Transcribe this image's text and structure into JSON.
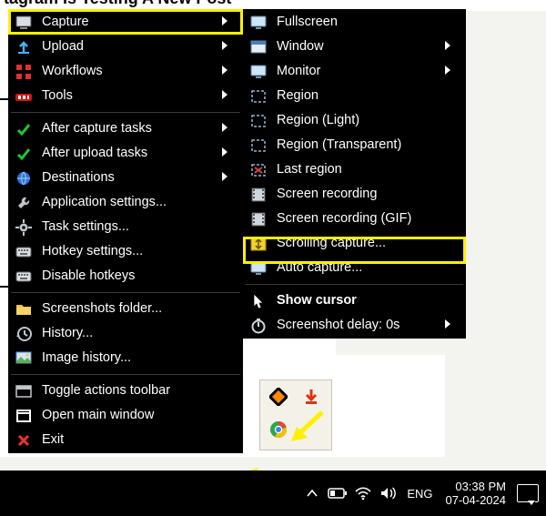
{
  "header_fragment": "tagram Is Testing A New Post",
  "main_menu": [
    {
      "label": "Capture",
      "icon": "capture",
      "sub": true,
      "kind": "item"
    },
    {
      "label": "Upload",
      "icon": "upload",
      "sub": true,
      "kind": "item"
    },
    {
      "label": "Workflows",
      "icon": "flow",
      "sub": true,
      "kind": "item"
    },
    {
      "label": "Tools",
      "icon": "tools",
      "sub": true,
      "kind": "item"
    },
    {
      "kind": "sep"
    },
    {
      "label": "After capture tasks",
      "icon": "check",
      "sub": true,
      "kind": "item"
    },
    {
      "label": "After upload tasks",
      "icon": "check",
      "sub": true,
      "kind": "item"
    },
    {
      "label": "Destinations",
      "icon": "dest",
      "sub": true,
      "kind": "item"
    },
    {
      "label": "Application settings...",
      "icon": "wrench",
      "kind": "item"
    },
    {
      "label": "Task settings...",
      "icon": "gear",
      "kind": "item"
    },
    {
      "label": "Hotkey settings...",
      "icon": "keyb",
      "kind": "item"
    },
    {
      "label": "Disable hotkeys",
      "icon": "keyb",
      "kind": "item"
    },
    {
      "kind": "sep"
    },
    {
      "label": "Screenshots folder...",
      "icon": "folder",
      "kind": "item"
    },
    {
      "label": "History...",
      "icon": "hist",
      "kind": "item"
    },
    {
      "label": "Image history...",
      "icon": "imghist",
      "kind": "item"
    },
    {
      "kind": "sep"
    },
    {
      "label": "Toggle actions toolbar",
      "icon": "toolbar",
      "kind": "item"
    },
    {
      "label": "Open main window",
      "icon": "open",
      "kind": "item"
    },
    {
      "label": "Exit",
      "icon": "exit",
      "kind": "item"
    }
  ],
  "sub_menu": [
    {
      "label": "Fullscreen",
      "icon": "mon",
      "kind": "item"
    },
    {
      "label": "Window",
      "icon": "win",
      "sub": true,
      "kind": "item"
    },
    {
      "label": "Monitor",
      "icon": "mon",
      "sub": true,
      "kind": "item"
    },
    {
      "label": "Region",
      "icon": "reg",
      "kind": "item"
    },
    {
      "label": "Region (Light)",
      "icon": "reg",
      "kind": "item"
    },
    {
      "label": "Region (Transparent)",
      "icon": "reg",
      "kind": "item"
    },
    {
      "label": "Last region",
      "icon": "regx",
      "kind": "item"
    },
    {
      "label": "Screen recording",
      "icon": "film",
      "kind": "item"
    },
    {
      "label": "Screen recording (GIF)",
      "icon": "film",
      "kind": "item"
    },
    {
      "label": "Scrolling capture...",
      "icon": "scroll",
      "kind": "item"
    },
    {
      "label": "Auto capture...",
      "icon": "mon",
      "kind": "item"
    },
    {
      "kind": "sep"
    },
    {
      "label": "Show cursor",
      "icon": "cursor",
      "bold": true,
      "kind": "item"
    },
    {
      "label": "Screenshot delay: 0s",
      "icon": "timer",
      "sub": true,
      "kind": "item"
    }
  ],
  "taskbar": {
    "lang": "ENG",
    "time": "03:38 PM",
    "date": "07-04-2024"
  }
}
